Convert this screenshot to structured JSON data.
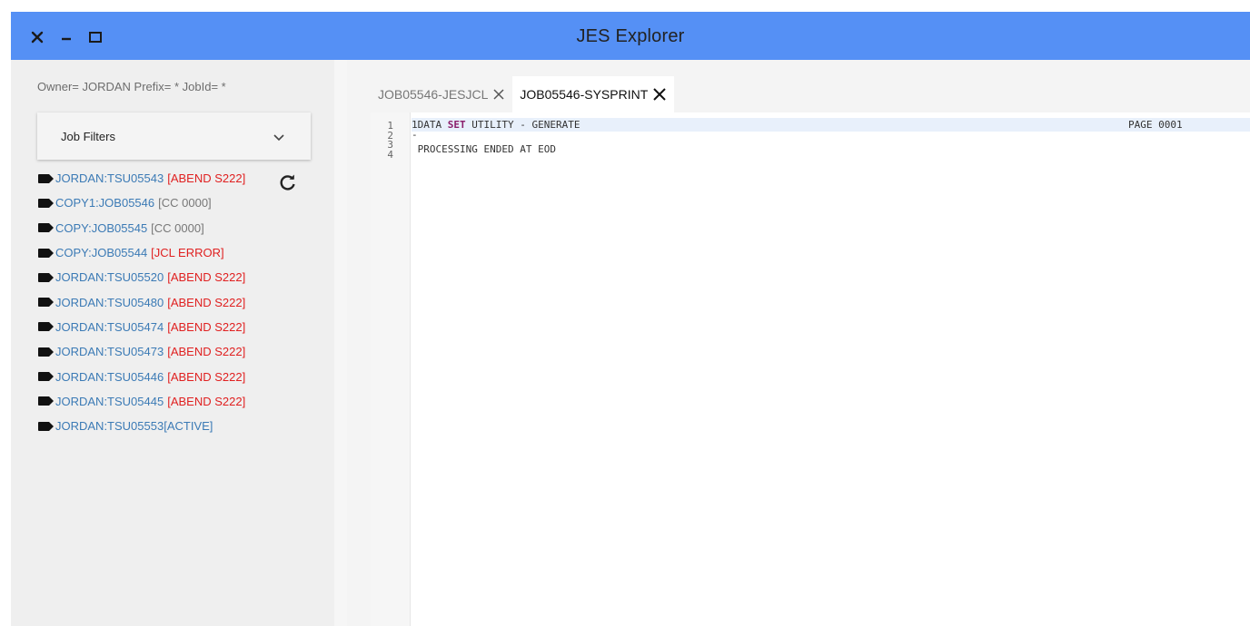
{
  "window": {
    "title": "JES Explorer",
    "controls": [
      "close-icon",
      "minimize-icon",
      "maximize-icon"
    ]
  },
  "sidebar": {
    "owner_line": "Owner= JORDAN Prefix= * JobId= *",
    "filters_label": "Job Filters",
    "jobs": [
      {
        "name": "JORDAN:TSU05543",
        "status": "[ABEND S222]",
        "kind": "error"
      },
      {
        "name": "COPY1:JOB05546",
        "status": "[CC 0000]",
        "kind": "ok"
      },
      {
        "name": "COPY:JOB05545",
        "status": "[CC 0000]",
        "kind": "ok"
      },
      {
        "name": "COPY:JOB05544",
        "status": "[JCL ERROR]",
        "kind": "error"
      },
      {
        "name": "JORDAN:TSU05520",
        "status": "[ABEND S222]",
        "kind": "error"
      },
      {
        "name": "JORDAN:TSU05480",
        "status": "[ABEND S222]",
        "kind": "error"
      },
      {
        "name": "JORDAN:TSU05474",
        "status": "[ABEND S222]",
        "kind": "error"
      },
      {
        "name": "JORDAN:TSU05473",
        "status": "[ABEND S222]",
        "kind": "error"
      },
      {
        "name": "JORDAN:TSU05446",
        "status": "[ABEND S222]",
        "kind": "error"
      },
      {
        "name": "JORDAN:TSU05445",
        "status": "[ABEND S222]",
        "kind": "error"
      },
      {
        "name": "JORDAN:TSU05553",
        "status": "[ACTIVE]",
        "kind": "active"
      }
    ]
  },
  "tabs": [
    {
      "label": "JOB05546-JESJCL",
      "active": false
    },
    {
      "label": "JOB05546-SYSPRINT",
      "active": true
    }
  ],
  "editor": {
    "lines": [
      {
        "num": "1",
        "prefix": "1DATA ",
        "keyword": "SET",
        "rest": " UTILITY - GENERATE",
        "page": "PAGE 0001"
      },
      {
        "num": "2",
        "prefix": "-",
        "keyword": "",
        "rest": "",
        "page": ""
      },
      {
        "num": "3",
        "prefix": " PROCESSING ENDED AT EOD",
        "keyword": "",
        "rest": "",
        "page": ""
      },
      {
        "num": "4",
        "prefix": "",
        "keyword": "",
        "rest": "",
        "page": ""
      }
    ]
  },
  "colors": {
    "titlebar": "#5590f5",
    "job_name": "#3b7ab5",
    "error_status": "#e02020",
    "ok_status": "#777777",
    "keyword": "#8a1d6b"
  }
}
